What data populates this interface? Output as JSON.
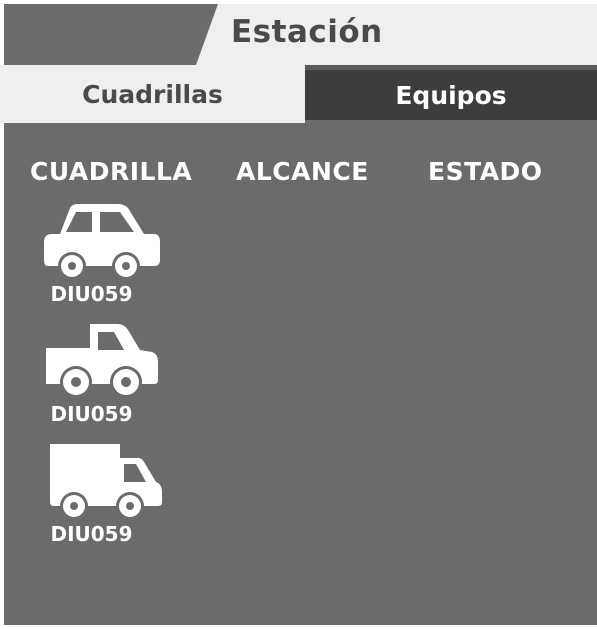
{
  "header": {
    "title": "Estación"
  },
  "tabs": [
    {
      "label": "Cuadrillas",
      "active": true
    },
    {
      "label": "Equipos",
      "active": false
    }
  ],
  "table": {
    "columns": [
      "CUADRILLA",
      "ALCANCE",
      "ESTADO"
    ]
  },
  "vehicles": [
    {
      "icon": "car-icon",
      "label": "DIU059"
    },
    {
      "icon": "pickup-truck-icon",
      "label": "DIU059"
    },
    {
      "icon": "box-truck-icon",
      "label": "DIU059"
    }
  ],
  "colors": {
    "panel": "#6b6b6b",
    "light": "#efefef",
    "dark_tab": "#3d3d3d",
    "text_dark": "#4a4a4a",
    "text_light": "#ffffff"
  }
}
